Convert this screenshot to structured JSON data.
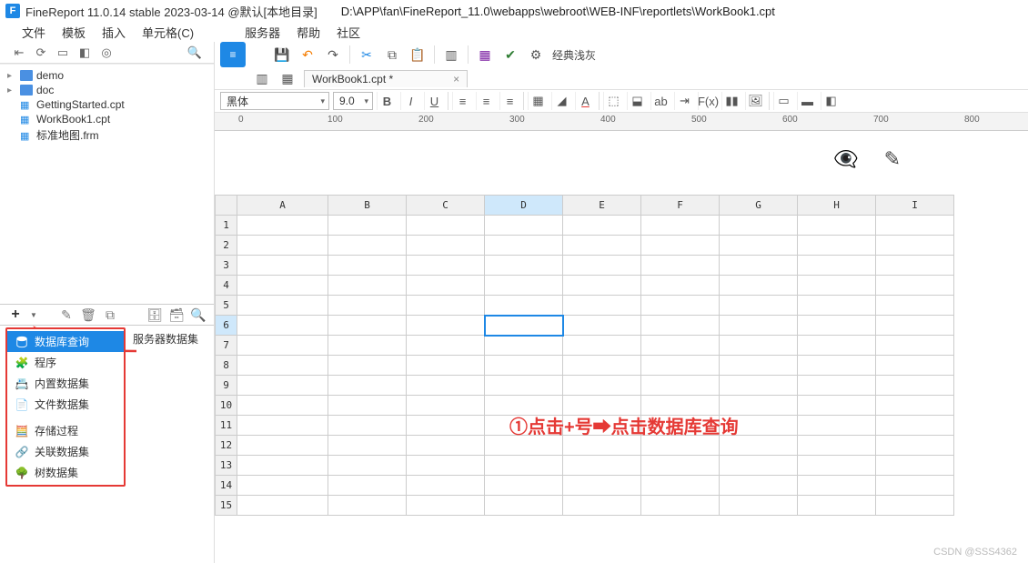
{
  "titlebar": {
    "app_icon": "F",
    "title": "FineReport 11.0.14 stable 2023-03-14 @默认[本地目录]",
    "path": "D:\\APP\\fan\\FineReport_11.0\\webapps\\webroot\\WEB-INF\\reportlets\\WorkBook1.cpt"
  },
  "menubar": [
    "文件",
    "模板",
    "插入",
    "单元格(C)",
    "服务器",
    "帮助",
    "社区"
  ],
  "left_tb_icons": [
    "collapse-icon",
    "refresh-icon",
    "open-icon",
    "view-icon",
    "locate-icon",
    "search-icon"
  ],
  "file_tree": [
    {
      "type": "folder",
      "label": "demo",
      "exp": "▸"
    },
    {
      "type": "folder",
      "label": "doc",
      "exp": "▸"
    },
    {
      "type": "file",
      "label": "GettingStarted.cpt"
    },
    {
      "type": "file",
      "label": "WorkBook1.cpt"
    },
    {
      "type": "file",
      "label": "标准地图.frm"
    }
  ],
  "ds_toolbar": {
    "plus": "+"
  },
  "ds_menu": [
    {
      "label": "数据库查询",
      "icon": "db",
      "sel": true
    },
    {
      "label": "程序",
      "icon": "proc"
    },
    {
      "label": "内置数据集",
      "icon": "builtin"
    },
    {
      "label": "文件数据集",
      "icon": "file"
    },
    {
      "label": "存储过程",
      "icon": "sp"
    },
    {
      "label": "关联数据集",
      "icon": "relation"
    },
    {
      "label": "树数据集",
      "icon": "tree"
    }
  ],
  "server_tab": "服务器数据集",
  "toolbar1": {
    "theme": "经典浅灰"
  },
  "tabs": [
    {
      "label": "WorkBook1.cpt *"
    }
  ],
  "toolbar2": {
    "font": "黑体",
    "size": "9.0"
  },
  "ruler_ticks": [
    "0",
    "100",
    "200",
    "300",
    "400",
    "500",
    "600",
    "700",
    "800"
  ],
  "columns": [
    "A",
    "B",
    "C",
    "D",
    "E",
    "F",
    "G",
    "H",
    "I"
  ],
  "rows": [
    "1",
    "2",
    "3",
    "4",
    "5",
    "6",
    "7",
    "8",
    "9",
    "10",
    "11",
    "12",
    "13",
    "14",
    "15"
  ],
  "selected_cell": {
    "row": 6,
    "col": "D"
  },
  "annotation": "①点击+号➡点击数据库查询",
  "watermark": "CSDN @SSS4362"
}
